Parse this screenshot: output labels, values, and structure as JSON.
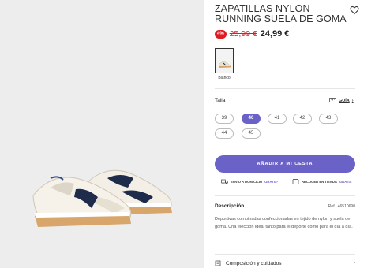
{
  "product": {
    "title": "ZAPATILLAS NYLON RUNNING SUELA DE GOMA",
    "discount_badge": "4%",
    "old_price": "25,99 €",
    "new_price": "24,99 €"
  },
  "color": {
    "label": "Blanco"
  },
  "size": {
    "label": "Talla",
    "guide_label": "GUÍA",
    "options": [
      "39",
      "40",
      "41",
      "42",
      "43",
      "44",
      "45"
    ],
    "selected": "40"
  },
  "cart": {
    "add_label": "AÑADIR A MI CESTA"
  },
  "shipping": {
    "home_label": "ENVÍO A DOMICILIO",
    "home_free": "GRATIS*",
    "store_label": "RECOGER EN TIENDA",
    "store_free": "GRATIS"
  },
  "description": {
    "heading": "Descripción",
    "ref": "Ref.: 46510690",
    "text": "Deportivas combinadas confeccionadas en tejido de nylon y suela de goma. Una elección ideal tanto para el deporte como para el día a día."
  },
  "composition": {
    "label": "Composición y cuidados"
  },
  "colors": {
    "accent": "#6b62c8",
    "sale": "#e11b22"
  }
}
